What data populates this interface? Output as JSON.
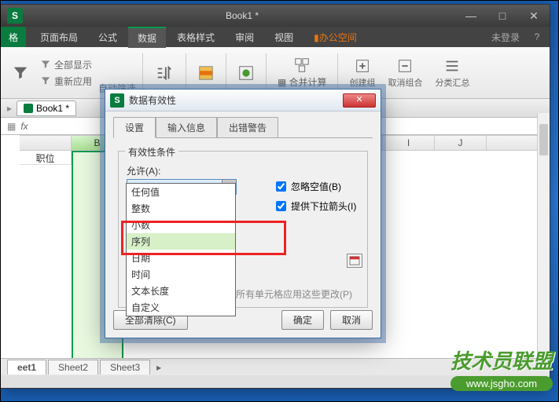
{
  "titlebar": {
    "doc": "Book1 *"
  },
  "winbtns": {
    "min": "—",
    "max": "□",
    "close": "✕"
  },
  "corner_tab": "格",
  "menu": {
    "items": [
      "页面布局",
      "公式",
      "数据",
      "表格样式",
      "审阅",
      "视图"
    ],
    "office": "办公空间",
    "login": "未登录",
    "active_index": 2
  },
  "ribbon": {
    "autofilter": "自动筛选",
    "showall": "全部显示",
    "reapply": "重新应用",
    "sort": "排序",
    "highlight": "高亮",
    "validation": "数据有效性",
    "consolidate": "合并计算",
    "group": "创建组",
    "ungroup": "取消组合",
    "subtotal": "分类汇总"
  },
  "sheet_tab": {
    "name": "Book1 *"
  },
  "formula": {
    "fx": "fx"
  },
  "columns": [
    "B",
    "I",
    "J"
  ],
  "cell_b1": "职位",
  "sheets": [
    "eet1",
    "Sheet2",
    "Sheet3"
  ],
  "dialog": {
    "title": "数据有效性",
    "tabs": [
      "设置",
      "输入信息",
      "出错警告"
    ],
    "fieldset": "有效性条件",
    "allow_label": "允许(A):",
    "combo_value": "序列",
    "options": [
      "任何值",
      "整数",
      "小数",
      "序列",
      "日期",
      "时间",
      "文本长度",
      "自定义"
    ],
    "hl_index": 3,
    "chk_ignore": "忽略空值(B)",
    "chk_dropdown": "提供下拉箭头(I)",
    "apply_all": "对所有同样设置的其他所有单元格应用这些更改(P)",
    "clear": "全部清除(C)",
    "ok": "确定",
    "cancel": "取消"
  },
  "watermark": {
    "text": "技术员联盟",
    "url": "www.jsgho.com"
  }
}
